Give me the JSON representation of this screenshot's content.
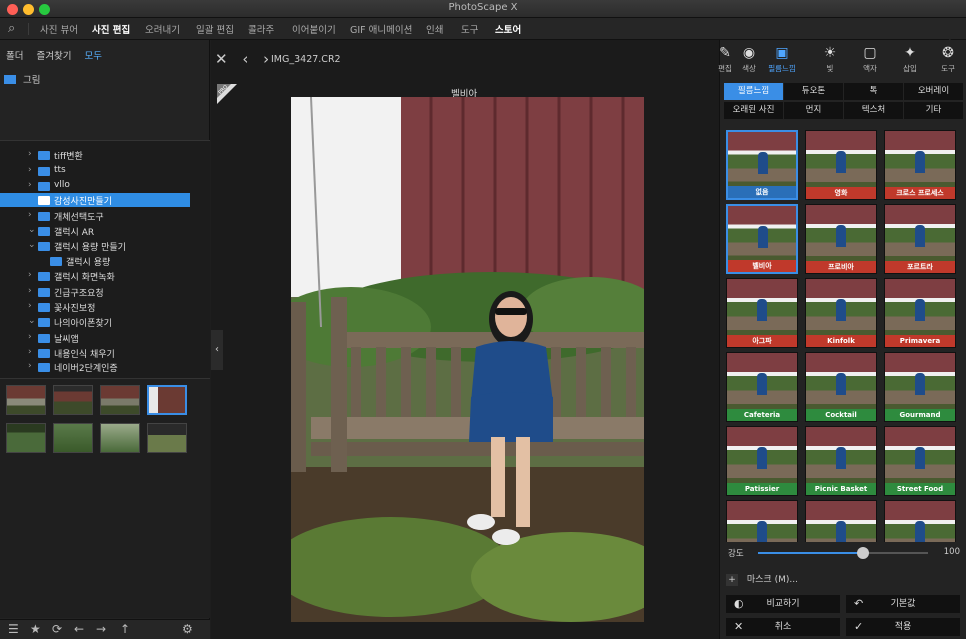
{
  "app": {
    "title": "PhotoScape X"
  },
  "top_tabs": [
    {
      "label": "사진 뷰어"
    },
    {
      "label": "사진 편집"
    },
    {
      "label": "오려내기"
    },
    {
      "label": "일괄 편집"
    },
    {
      "label": "콜라주"
    },
    {
      "label": "이어붙이기"
    },
    {
      "label": "GIF 애니메이션"
    },
    {
      "label": "인쇄"
    },
    {
      "label": "도구"
    },
    {
      "label": "스토어"
    }
  ],
  "left_panel": {
    "tabs": [
      "폴더",
      "즐겨찾기",
      "모두"
    ],
    "root_folder": "그림",
    "tree": [
      {
        "label": "tiff변환",
        "chev": "›"
      },
      {
        "label": "tts",
        "chev": "›"
      },
      {
        "label": "vllo",
        "chev": "›"
      },
      {
        "label": "감성사진만들기",
        "chev": ""
      },
      {
        "label": "개체선택도구",
        "chev": "›"
      },
      {
        "label": "갤럭시 AR",
        "chev": "⌄"
      },
      {
        "label": "갤럭시 용량 만들기",
        "chev": "⌄"
      },
      {
        "label": "갤럭시 용량",
        "chev": ""
      },
      {
        "label": "갤럭시 화면녹화",
        "chev": "›"
      },
      {
        "label": "긴급구조요청",
        "chev": "›"
      },
      {
        "label": "꽃사진보정",
        "chev": "›"
      },
      {
        "label": "나의아이폰찾기",
        "chev": "⌄"
      },
      {
        "label": "날씨앱",
        "chev": "›"
      },
      {
        "label": "내용인식 채우기",
        "chev": "›"
      },
      {
        "label": "네이버2단계인증",
        "chev": "›"
      }
    ]
  },
  "center": {
    "filename": "IMG_3427.CR2",
    "filter_label": "벨비아",
    "pro_badge": "PRO"
  },
  "right_panel": {
    "tools": [
      {
        "label": "편집"
      },
      {
        "label": "색상"
      },
      {
        "label": "필름느낌"
      },
      {
        "label": "빛"
      },
      {
        "label": "액자"
      },
      {
        "label": "삽입"
      },
      {
        "label": "도구"
      }
    ],
    "filter_tabs": [
      "필름느낌",
      "듀오톤",
      "톡",
      "오버레이",
      "오래된 사진",
      "먼지",
      "텍스처",
      "기타"
    ],
    "filters": [
      {
        "label": "없음",
        "cap": "#2a6fb8"
      },
      {
        "label": "영화",
        "cap": "#c0392b"
      },
      {
        "label": "크로스 프로세스",
        "cap": "#c0392b"
      },
      {
        "label": "벨비아",
        "cap": "#c0392b"
      },
      {
        "label": "프로비아",
        "cap": "#c0392b"
      },
      {
        "label": "포르트라",
        "cap": "#c0392b"
      },
      {
        "label": "아그파",
        "cap": "#c0392b"
      },
      {
        "label": "Kinfolk",
        "cap": "#c0392b"
      },
      {
        "label": "Primavera",
        "cap": "#c0392b"
      },
      {
        "label": "Cafeteria",
        "cap": "#2e8b3e"
      },
      {
        "label": "Cocktail",
        "cap": "#2e8b3e"
      },
      {
        "label": "Gourmand",
        "cap": "#2e8b3e"
      },
      {
        "label": "Patissier",
        "cap": "#2e8b3e"
      },
      {
        "label": "Picnic Basket",
        "cap": "#2e8b3e"
      },
      {
        "label": "Street Food",
        "cap": "#2e8b3e"
      },
      {
        "label": "",
        "cap": ""
      },
      {
        "label": "",
        "cap": ""
      },
      {
        "label": "",
        "cap": ""
      }
    ],
    "intensity_label": "강도",
    "intensity_value": "100",
    "intensity_level": 0.62,
    "mask_label": "마스크 (M)...",
    "compare_label": "비교하기",
    "default_label": "기본값",
    "cancel_label": "취소",
    "apply_label": "적용"
  },
  "colors": {
    "accent": "#3a8ee6"
  }
}
